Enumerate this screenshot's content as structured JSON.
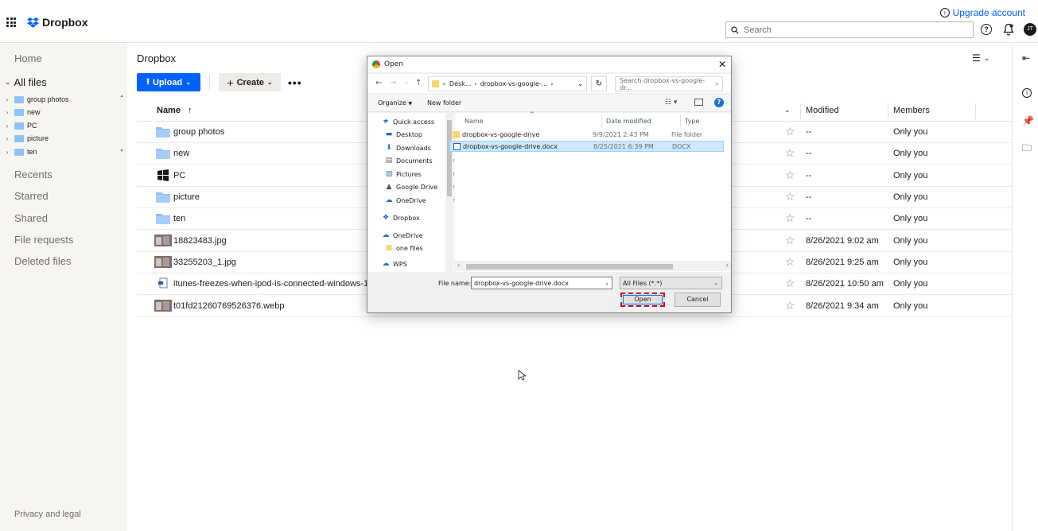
{
  "app": {
    "brand": "Dropbox",
    "upgrade_label": "Upgrade account",
    "search_placeholder": "Search",
    "avatar_initials": "JT"
  },
  "sidebar": {
    "home": "Home",
    "all_files": "All files",
    "tree": [
      "group photos",
      "new",
      "PC",
      "picture",
      "ten"
    ],
    "recents": "Recents",
    "starred": "Starred",
    "shared": "Shared",
    "file_requests": "File requests",
    "deleted_files": "Deleted files",
    "privacy": "Privacy and legal"
  },
  "main": {
    "breadcrumb": "Dropbox",
    "upload_label": "Upload",
    "create_label": "Create",
    "more_label": "•••",
    "columns": {
      "name": "Name",
      "modified": "Modified",
      "members": "Members"
    },
    "rows": [
      {
        "name": "group photos",
        "kind": "folder",
        "modified": "--",
        "members": "Only you"
      },
      {
        "name": "new",
        "kind": "folder",
        "modified": "--",
        "members": "Only you"
      },
      {
        "name": "PC",
        "kind": "windows",
        "modified": "--",
        "members": "Only you"
      },
      {
        "name": "picture",
        "kind": "folder",
        "modified": "--",
        "members": "Only you"
      },
      {
        "name": "ten",
        "kind": "folder",
        "modified": "--",
        "members": "Only you"
      },
      {
        "name": "18823483.jpg",
        "kind": "image",
        "modified": "8/26/2021 9:02 am",
        "members": "Only you"
      },
      {
        "name": "33255203_1.jpg",
        "kind": "image",
        "modified": "8/26/2021 9:25 am",
        "members": "Only you"
      },
      {
        "name": "itunes-freezes-when-ipod-is-connected-windows-10.c",
        "kind": "doc",
        "modified": "8/26/2021 10:50 am",
        "members": "Only you"
      },
      {
        "name": "t01fd21260769526376.webp",
        "kind": "image",
        "modified": "8/26/2021 9:34 am",
        "members": "Only you"
      }
    ]
  },
  "dialog": {
    "title": "Open",
    "address": [
      "Desk...",
      "dropbox-vs-google-..."
    ],
    "search_placeholder": "Search dropbox-vs-google-dr...",
    "organize": "Organize",
    "new_folder": "New folder",
    "nav_items": [
      {
        "label": "Quick access",
        "icon": "star-icon"
      },
      {
        "label": "Desktop",
        "icon": "desktop-icon"
      },
      {
        "label": "Downloads",
        "icon": "download-icon"
      },
      {
        "label": "Documents",
        "icon": "documents-icon"
      },
      {
        "label": "Pictures",
        "icon": "pictures-icon"
      },
      {
        "label": "Google Drive",
        "icon": "drive-icon"
      },
      {
        "label": "OneDrive",
        "icon": "cloud-icon"
      },
      {
        "label": "Dropbox",
        "icon": "dropbox-icon"
      },
      {
        "label": "OneDrive",
        "icon": "cloud-icon"
      },
      {
        "label": "one files",
        "icon": "folder-icon"
      },
      {
        "label": "WPS",
        "icon": "cloud-icon"
      }
    ],
    "columns": {
      "name": "Name",
      "date": "Date modified",
      "type": "Type"
    },
    "files": [
      {
        "name": "dropbox-vs-google-drive",
        "date": "9/9/2021 2:43 PM",
        "type": "File folder"
      },
      {
        "name": "dropbox-vs-google-drive.docx",
        "date": "8/25/2021 6:39 PM",
        "type": "DOCX"
      }
    ],
    "file_name_label": "File name:",
    "file_name_value": "dropbox-vs-google-drive.docx",
    "file_type": "All Files (*.*)",
    "open_label": "Open",
    "cancel_label": "Cancel"
  },
  "colors": {
    "accent": "#0061fe",
    "folder": "#92c1f9",
    "selection": "#cce8ff",
    "focus": "#d6001c"
  }
}
